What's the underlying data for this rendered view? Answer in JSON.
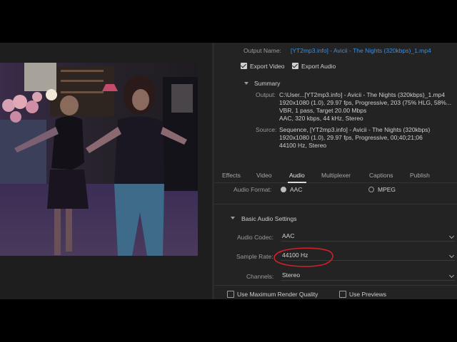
{
  "export": {
    "output_name_label": "Output Name:",
    "output_name_value": "[YT2mp3.info] - Avicii - The Nights (320kbps)_1.mp4",
    "export_video_label": "Export Video",
    "export_audio_label": "Export Audio",
    "summary_label": "Summary",
    "output_label": "Output:",
    "output_lines": [
      "C:\\User...[YT2mp3.info] - Avicii - The Nights (320kbps)_1.mp4",
      "1920x1080 (1.0), 29.97 fps, Progressive, 203 (75% HLG, 58%...",
      "VBR, 1 pass, Target 20.00 Mbps",
      "AAC, 320 kbps, 44 kHz, Stereo"
    ],
    "source_label": "Source:",
    "source_lines": [
      "Sequence, [YT2mp3.info] - Avicii - The Nights (320kbps)",
      "1920x1080 (1.0), 29.97 fps, Progressive, 00;40;21;06",
      "44100 Hz, Stereo"
    ]
  },
  "tabs": [
    "Effects",
    "Video",
    "Audio",
    "Multiplexer",
    "Captions",
    "Publish"
  ],
  "active_tab": "Audio",
  "audio": {
    "format_label": "Audio Format:",
    "format_options": [
      "AAC",
      "MPEG"
    ],
    "selected_format": "AAC",
    "basic_settings_label": "Basic Audio Settings",
    "codec_label": "Audio Codec:",
    "codec_value": "AAC",
    "sample_rate_label": "Sample Rate:",
    "sample_rate_value": "44100 Hz",
    "channels_label": "Channels:",
    "channels_value": "Stereo"
  },
  "footer": {
    "max_render_label": "Use Maximum Render Quality",
    "use_previews_label": "Use Previews"
  },
  "annotation_color": "#d0202a",
  "link_color": "#3d8fe0"
}
